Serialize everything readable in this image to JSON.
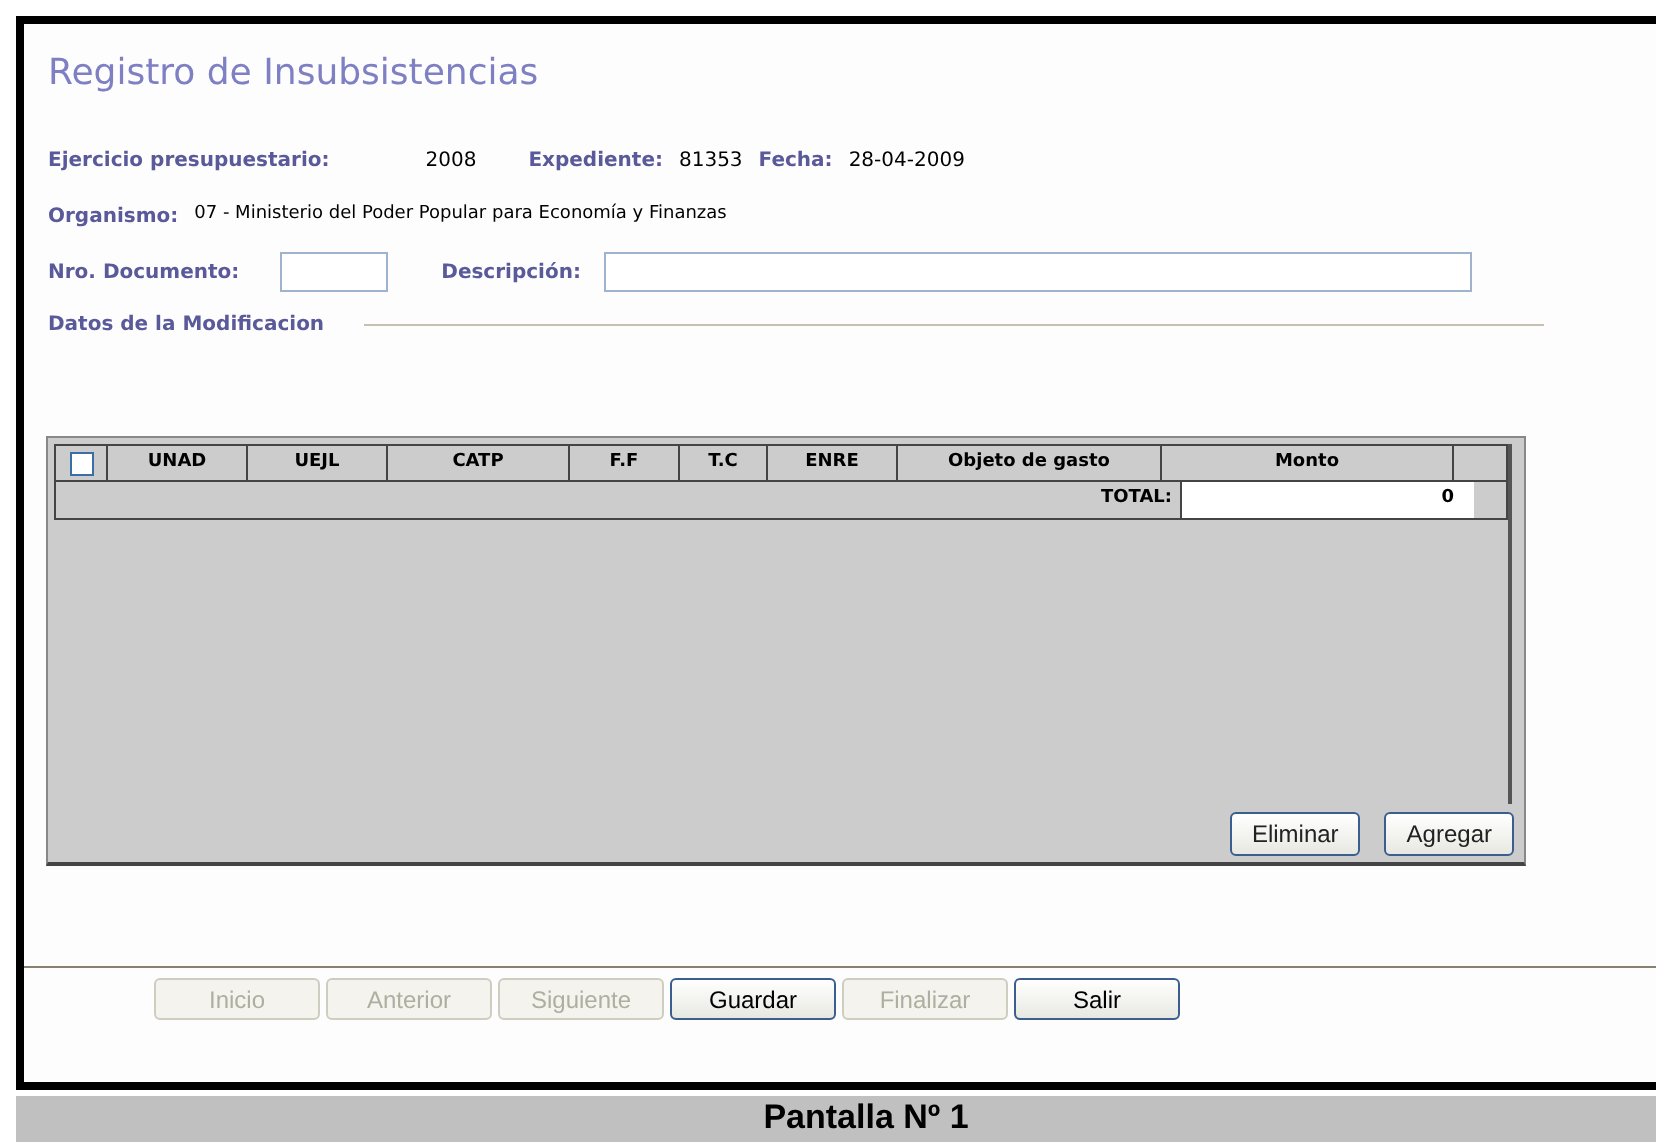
{
  "title": "Registro de Insubsistencias",
  "info": [
    {
      "label": "Ejercicio presupuestario:",
      "value": "2008"
    },
    {
      "label": "Expediente:",
      "value": "81353"
    },
    {
      "label": "Fecha:",
      "value": "28-04-2009"
    }
  ],
  "organismo": {
    "label": "Organismo:",
    "value": "07 - Ministerio del Poder Popular para Economía y Finanzas"
  },
  "fields": [
    {
      "label": "Nro. Documento:",
      "kind": "short"
    },
    {
      "label": "Descripción:",
      "kind": "long"
    }
  ],
  "section": "Datos de la Modificacion",
  "table": {
    "select_all": {
      "checked": false
    },
    "columns": [
      "UNAD",
      "UEJL",
      "CATP",
      "F.F",
      "T.C",
      "ENRE",
      "Objeto de gasto",
      "Monto"
    ],
    "total_label": "TOTAL:",
    "total_value": "0"
  },
  "table_buttons": [
    "Eliminar",
    "Agregar"
  ],
  "nav_buttons": [
    {
      "label": "Inicio",
      "disabled": true
    },
    {
      "label": "Anterior",
      "disabled": true
    },
    {
      "label": "Siguiente",
      "disabled": true
    },
    {
      "label": "Guardar",
      "disabled": false
    },
    {
      "label": "Finalizar",
      "disabled": true
    },
    {
      "label": "Salir",
      "disabled": false
    }
  ],
  "caption": "Pantalla Nº 1"
}
